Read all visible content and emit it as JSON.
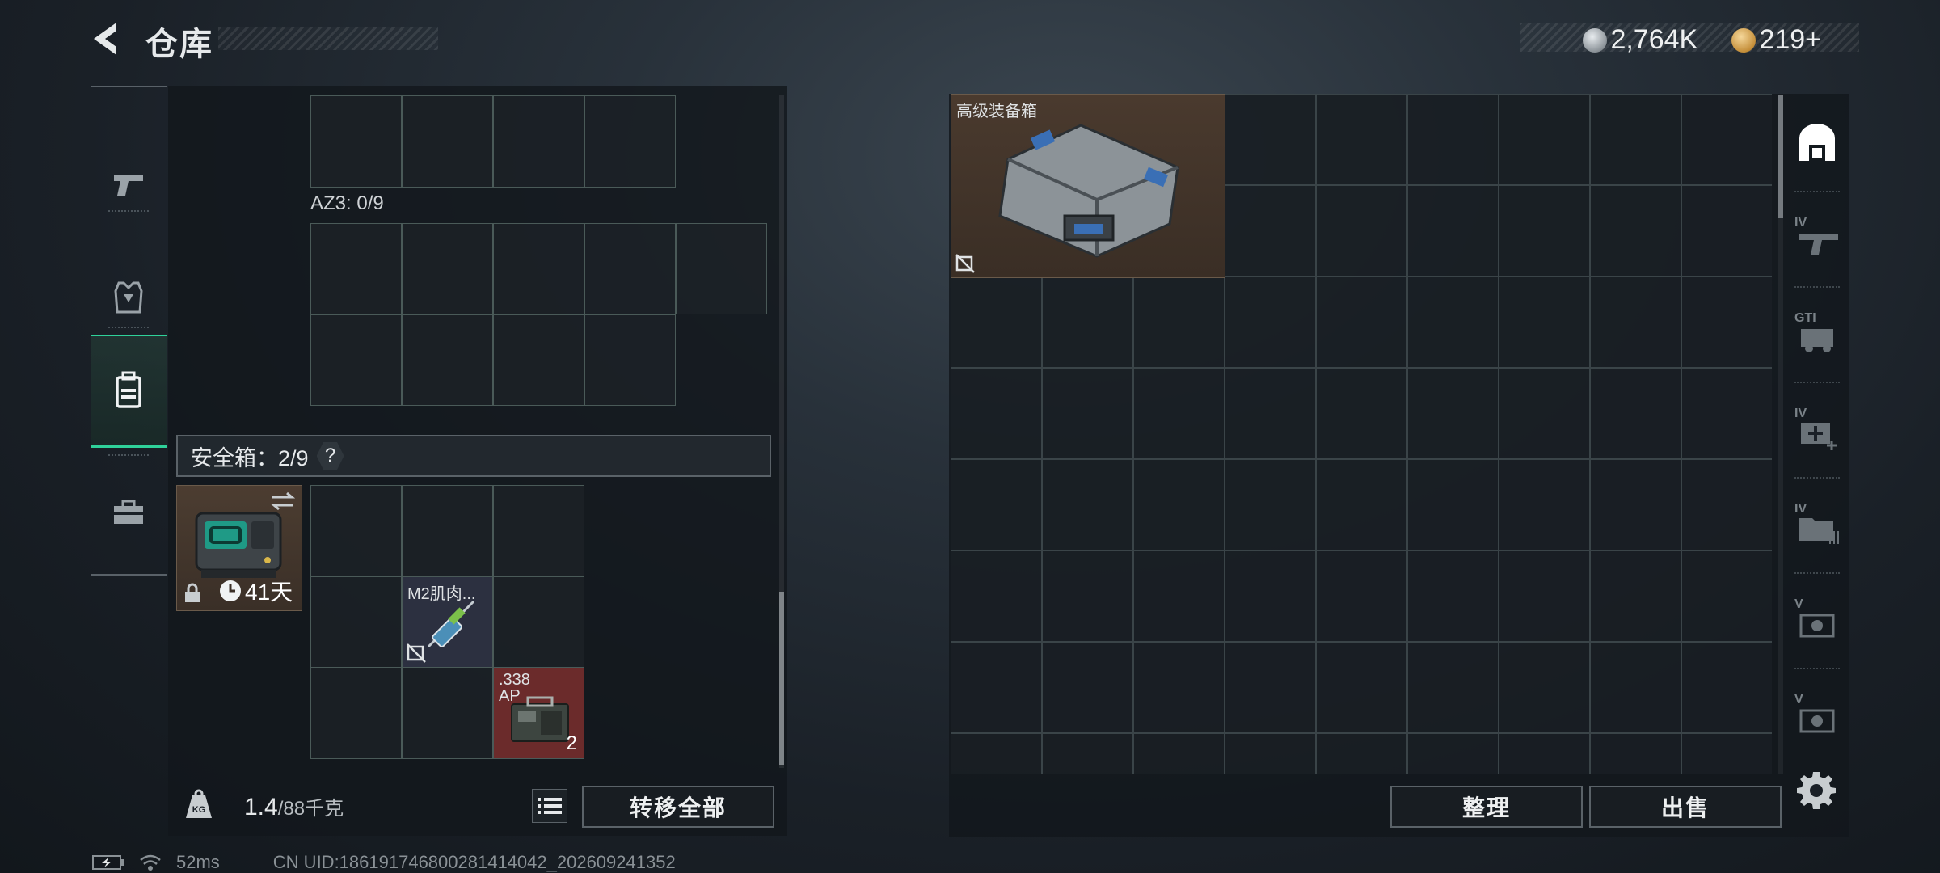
{
  "header": {
    "title": "仓库",
    "currencies": [
      {
        "icon": "silver-coin-icon",
        "value": "2,764K"
      },
      {
        "icon": "gold-triangle-coin-icon",
        "value": "219+"
      }
    ]
  },
  "left_nav": {
    "items": [
      {
        "name": "weapons-tab",
        "icon": "pistol-icon"
      },
      {
        "name": "armor-tab",
        "icon": "armor-vest-icon"
      },
      {
        "name": "backpack-tab",
        "icon": "backpack-icon",
        "active": true
      },
      {
        "name": "tools-tab",
        "icon": "toolbox-icon"
      }
    ]
  },
  "loadout": {
    "az3_label": "AZ3: 0/9",
    "safe_header": "安全箱：2/9",
    "safe_help": "?",
    "safebox": {
      "duration": "41天",
      "icon": "safebox-icon"
    },
    "items": [
      {
        "name": "M2肌肉...",
        "icon": "syringe-icon",
        "count": ""
      },
      {
        "name": ".338\nAP",
        "icon": "ammo-box-icon",
        "count": "2"
      }
    ]
  },
  "footer_left": {
    "weight_value": "1.4",
    "weight_max": "/88千克",
    "weight_icon_label": "KG",
    "transfer_all": "转移全部"
  },
  "stash": {
    "items": [
      {
        "name": "高级装备箱",
        "icon": "equipment-case-icon"
      }
    ],
    "organize": "整理",
    "sell": "出售"
  },
  "right_tabs": [
    {
      "label": "",
      "icon": "safehouse-icon"
    },
    {
      "label": "IV",
      "icon": "weapon-rack-icon"
    },
    {
      "label": "GTI",
      "icon": "vehicle-icon"
    },
    {
      "label": "IV",
      "icon": "medical-icon"
    },
    {
      "label": "IV",
      "icon": "folder-icon"
    },
    {
      "label": "V",
      "icon": "cash-icon"
    },
    {
      "label": "V",
      "icon": "cash-icon-2"
    }
  ],
  "status_bar": {
    "ping": "52ms",
    "uid": "CN UID:186191746800281414042_202609241352"
  },
  "colors": {
    "accent_green": "#2fd29a",
    "rare_brown": "#4c3d31",
    "ammo_red": "#6b2b2b",
    "med_purple": "#2c3040"
  }
}
